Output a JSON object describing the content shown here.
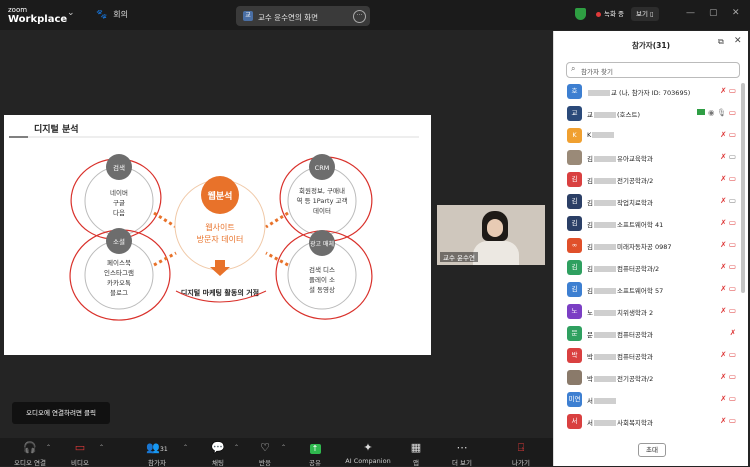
{
  "topbar": {
    "logo_top": "zoom",
    "logo_bottom": "Workplace",
    "meeting_label": "회의",
    "tab_icon_text": "교",
    "tab_title": "교수 윤수연의 화면",
    "recording_label": "녹화 중",
    "view_label": "보기"
  },
  "slide": {
    "title": "디지털 분석",
    "center_title": "웹분석",
    "center_sub": [
      "웹사이트",
      "방문자 데이터"
    ],
    "arrow_caption": "디지털 마케팅 활동의 거점",
    "nodes": [
      {
        "badge": "검색",
        "lines": [
          "네이버",
          "구글",
          "다음"
        ]
      },
      {
        "badge": "CRM",
        "lines": [
          "회원정보, 구매내",
          "역 등 1Party 고객",
          "데이터"
        ]
      },
      {
        "badge": "소셜",
        "lines": [
          "페이스북",
          "인스타그램",
          "카카오톡",
          "블로그"
        ]
      },
      {
        "badge": "광고\n매체",
        "lines": [
          "검색 디스",
          "플레이 소",
          "셜 동영상"
        ]
      }
    ],
    "colors": {
      "accent": "#e8722a",
      "badge_bg": "#6d6d6d",
      "annotation": "#d9312b"
    }
  },
  "video_thumb": {
    "label": "교수 윤수연"
  },
  "panel": {
    "title": "참가자(31)",
    "search_placeholder": "참가자 찾기",
    "invite_label": "초대",
    "participants": [
      {
        "avatar": "호",
        "color": "#3d7fd1",
        "name_pre": "",
        "name_post": "교 (나, 참가자",
        "extra": "ID: 703695)",
        "status": "muted-video-off"
      },
      {
        "avatar": "교",
        "color": "#2b4a7a",
        "name_pre": "교",
        "name_post": "(호스트)",
        "extra": "",
        "status": "host"
      },
      {
        "avatar": "K",
        "color": "#f0a030",
        "name_pre": "K",
        "name_post": "",
        "extra": "",
        "status": "muted-video-off"
      },
      {
        "avatar": "",
        "color": "#9a8a78",
        "name_pre": "김",
        "name_post": "유아교육학과",
        "extra": "",
        "status": "muted-video-on"
      },
      {
        "avatar": "김",
        "color": "#d94040",
        "name_pre": "김",
        "name_post": "전기공학과/2",
        "extra": "",
        "status": "muted-video-off"
      },
      {
        "avatar": "김",
        "color": "#2b3f66",
        "name_pre": "김",
        "name_post": "작업치료학과",
        "extra": "",
        "status": "muted-video-on"
      },
      {
        "avatar": "김",
        "color": "#2b3f66",
        "name_pre": "김",
        "name_post": "소프트웨어학",
        "extra": "41",
        "status": "muted-video-off"
      },
      {
        "avatar": "∞",
        "color": "#e0502a",
        "name_pre": "김",
        "name_post": "미래자동차공",
        "extra": "0987",
        "status": "muted-video-off"
      },
      {
        "avatar": "김",
        "color": "#2fa060",
        "name_pre": "김",
        "name_post": "컴퓨터공학과/2",
        "extra": "",
        "status": "muted-video-off"
      },
      {
        "avatar": "김",
        "color": "#3d7fd1",
        "name_pre": "김",
        "name_post": "소프트웨어학",
        "extra": "57",
        "status": "muted-video-off"
      },
      {
        "avatar": "노",
        "color": "#7b3fc4",
        "name_pre": "노",
        "name_post": "치위생학과",
        "extra": "2",
        "status": "muted-video-off"
      },
      {
        "avatar": "문",
        "color": "#2fa060",
        "name_pre": "문",
        "name_post": "컴퓨터공학과",
        "extra": "",
        "status": "muted"
      },
      {
        "avatar": "박",
        "color": "#d94040",
        "name_pre": "박",
        "name_post": "컴퓨터공학과",
        "extra": "",
        "status": "muted-video-off"
      },
      {
        "avatar": "",
        "color": "#8a7a6a",
        "name_pre": "박",
        "name_post": "전기공학과/2",
        "extra": "",
        "status": "muted-video-off"
      },
      {
        "avatar": "미연",
        "color": "#3d7fd1",
        "name_pre": "서",
        "name_post": "",
        "extra": "",
        "status": "muted-video-off"
      },
      {
        "avatar": "서",
        "color": "#d94040",
        "name_pre": "서",
        "name_post": "사회복지학과",
        "extra": "",
        "status": "muted-video-off"
      }
    ]
  },
  "tooltip": "오디오에 연결하려면 클릭",
  "toolbar": {
    "audio": "오디오 연결",
    "video": "비디오",
    "participants": "참가자",
    "participants_count": "31",
    "chat": "채팅",
    "react": "반응",
    "share": "공유",
    "ai": "AI Companion",
    "apps": "앱",
    "more": "더 보기",
    "leave": "나가기"
  }
}
